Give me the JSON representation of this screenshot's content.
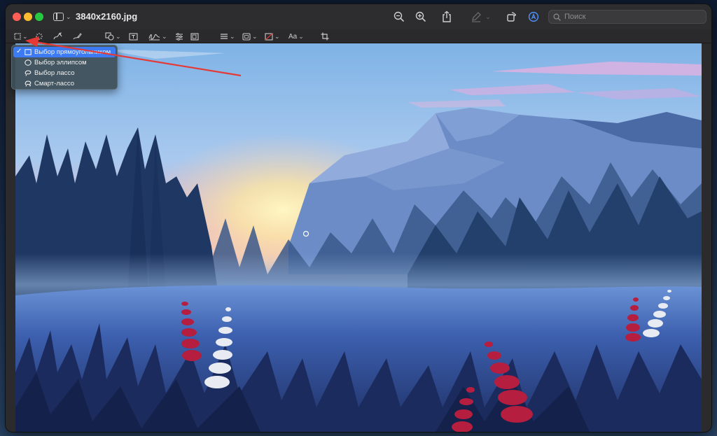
{
  "window": {
    "title": "3840x2160.jpg"
  },
  "toolbar": {
    "icons": [
      "sidebar-toggle-icon",
      "zoom-out-icon",
      "zoom-in-icon",
      "share-icon",
      "highlight-pen-icon",
      "rotate-icon",
      "markup-icon"
    ],
    "search_placeholder": "Поиск"
  },
  "markup_toolbar": {
    "icons": [
      "rectangle-select-icon",
      "instant-alpha-icon",
      "sketch-icon",
      "draw-icon",
      "shapes-icon",
      "text-box-icon",
      "sign-icon",
      "adjust-color-icon",
      "adjust-size-icon",
      "shape-style-icon",
      "border-color-icon",
      "fill-color-icon",
      "text-style-icon",
      "crop-icon"
    ],
    "text_style_label": "Aa"
  },
  "selection_menu": {
    "items": [
      {
        "label": "Выбор прямоугольником",
        "checked": true,
        "icon": "rectangle-icon"
      },
      {
        "label": "Выбор эллипсом",
        "checked": false,
        "icon": "ellipse-icon"
      },
      {
        "label": "Выбор лассо",
        "checked": false,
        "icon": "lasso-icon"
      },
      {
        "label": "Смарт-лассо",
        "checked": false,
        "icon": "smart-lasso-icon"
      }
    ],
    "check_mark": "✓"
  },
  "colors": {
    "accent": "#3d7bf5",
    "annotation_arrow": "#e53935"
  }
}
